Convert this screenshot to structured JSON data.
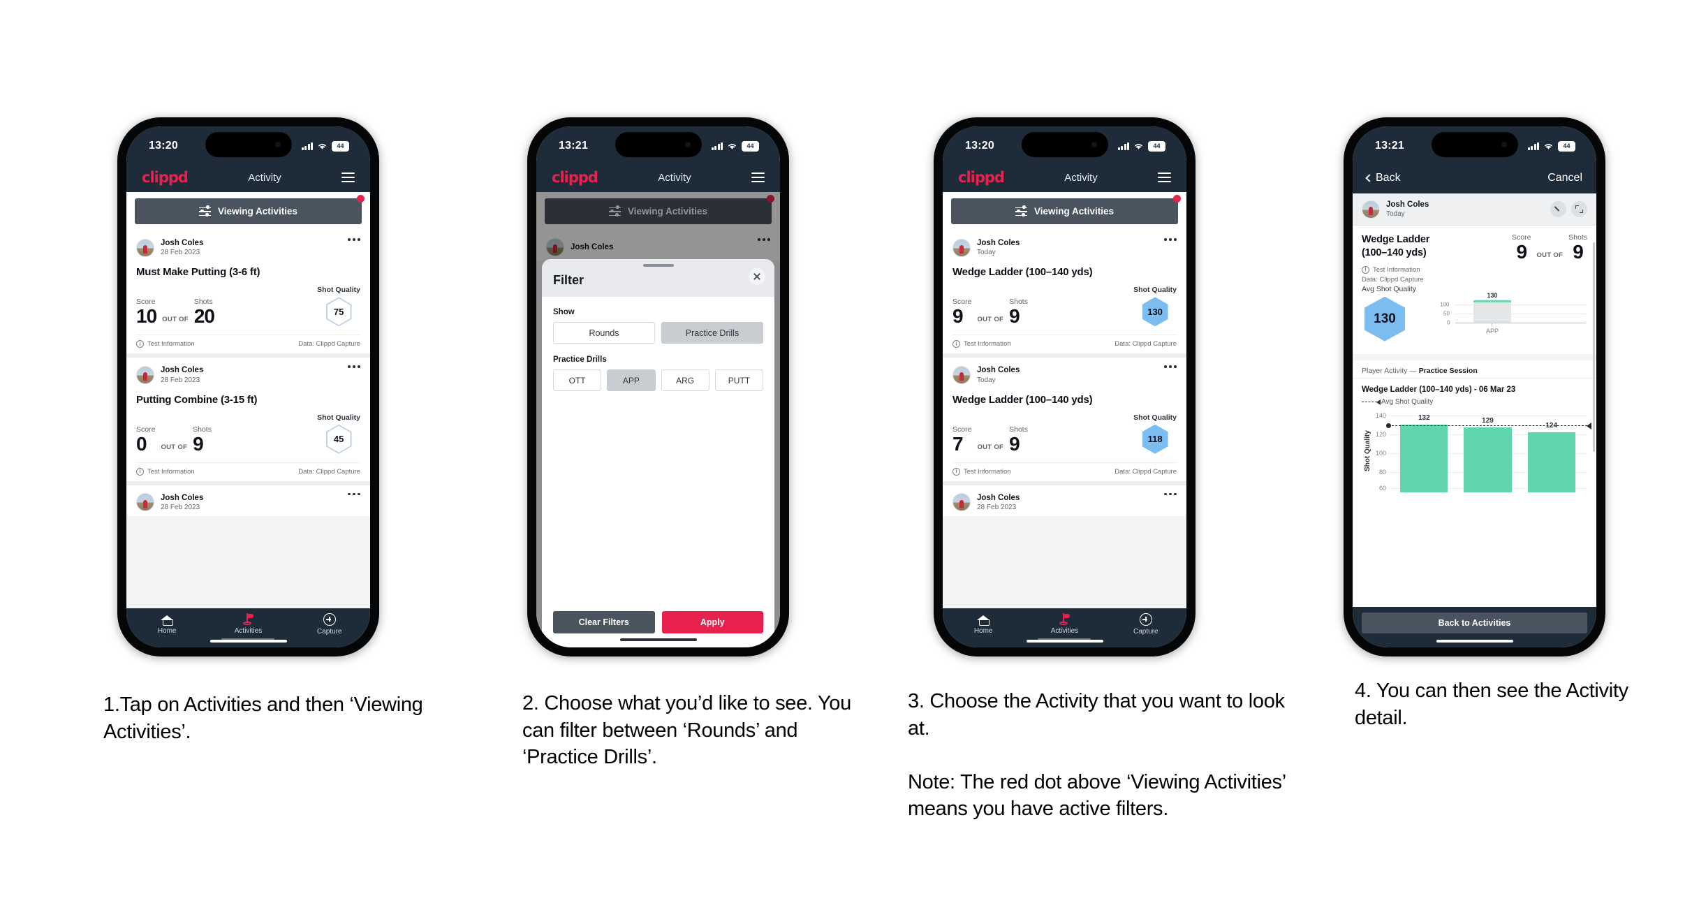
{
  "phones": [
    {
      "status": {
        "time": "13:20",
        "battery": "44"
      },
      "appbar": {
        "logo": "clippd",
        "title": "Activity"
      },
      "filter_button": {
        "label": "Viewing Activities",
        "has_badge": true
      },
      "cards": [
        {
          "user": "Josh Coles",
          "date": "28 Feb 2023",
          "title": "Must Make Putting (3-6 ft)",
          "score_label": "Score",
          "score": "10",
          "outof": "OUT OF",
          "shots_label": "Shots",
          "shots": "20",
          "quality_label": "Shot Quality",
          "quality": "75",
          "quality_style": "outline",
          "foot_left": "Test Information",
          "foot_right": "Data: Clippd Capture"
        },
        {
          "user": "Josh Coles",
          "date": "28 Feb 2023",
          "title": "Putting Combine (3-15 ft)",
          "score_label": "Score",
          "score": "0",
          "outof": "OUT OF",
          "shots_label": "Shots",
          "shots": "9",
          "quality_label": "Shot Quality",
          "quality": "45",
          "quality_style": "outline",
          "foot_left": "Test Information",
          "foot_right": "Data: Clippd Capture"
        }
      ],
      "partial_card": {
        "user": "Josh Coles",
        "date": "28 Feb 2023"
      },
      "tabs": [
        {
          "label": "Home",
          "icon": "home-icon",
          "active": false
        },
        {
          "label": "Activities",
          "icon": "golf-flag-icon",
          "active": true
        },
        {
          "label": "Capture",
          "icon": "plus-circle-icon",
          "active": false
        }
      ]
    },
    {
      "status": {
        "time": "13:21",
        "battery": "44"
      },
      "appbar": {
        "logo": "clippd",
        "title": "Activity"
      },
      "filter_button": {
        "label": "Viewing Activities",
        "has_badge": true
      },
      "bg_card_user": "Josh Coles",
      "sheet": {
        "title": "Filter",
        "show_label": "Show",
        "show_options": [
          {
            "label": "Rounds",
            "selected": false
          },
          {
            "label": "Practice Drills",
            "selected": true
          }
        ],
        "drills_label": "Practice Drills",
        "drill_options": [
          {
            "label": "OTT",
            "selected": false
          },
          {
            "label": "APP",
            "selected": true
          },
          {
            "label": "ARG",
            "selected": false
          },
          {
            "label": "PUTT",
            "selected": false
          }
        ],
        "clear_label": "Clear Filters",
        "apply_label": "Apply"
      }
    },
    {
      "status": {
        "time": "13:20",
        "battery": "44"
      },
      "appbar": {
        "logo": "clippd",
        "title": "Activity"
      },
      "filter_button": {
        "label": "Viewing Activities",
        "has_badge": true
      },
      "cards": [
        {
          "user": "Josh Coles",
          "date": "Today",
          "title": "Wedge Ladder (100–140 yds)",
          "score_label": "Score",
          "score": "9",
          "outof": "OUT OF",
          "shots_label": "Shots",
          "shots": "9",
          "quality_label": "Shot Quality",
          "quality": "130",
          "quality_style": "filled",
          "foot_left": "Test Information",
          "foot_right": "Data: Clippd Capture"
        },
        {
          "user": "Josh Coles",
          "date": "Today",
          "title": "Wedge Ladder (100–140 yds)",
          "score_label": "Score",
          "score": "7",
          "outof": "OUT OF",
          "shots_label": "Shots",
          "shots": "9",
          "quality_label": "Shot Quality",
          "quality": "118",
          "quality_style": "filled",
          "foot_left": "Test Information",
          "foot_right": "Data: Clippd Capture"
        }
      ],
      "partial_card": {
        "user": "Josh Coles",
        "date": "28 Feb 2023"
      },
      "tabs": [
        {
          "label": "Home",
          "icon": "home-icon",
          "active": false
        },
        {
          "label": "Activities",
          "icon": "golf-flag-icon",
          "active": true
        },
        {
          "label": "Capture",
          "icon": "plus-circle-icon",
          "active": false
        }
      ]
    },
    {
      "status": {
        "time": "13:21",
        "battery": "44"
      },
      "navbar": {
        "back": "Back",
        "cancel": "Cancel"
      },
      "detail_head": {
        "user": "Josh Coles",
        "date": "Today"
      },
      "detail": {
        "title": "Wedge Ladder (100–140 yds)",
        "score_label": "Score",
        "score": "9",
        "outof": "OUT OF",
        "shots_label": "Shots",
        "shots": "9",
        "info_line1": "Test Information",
        "info_line2": "Data: Clippd Capture",
        "avg_label": "Avg Shot Quality",
        "avg_value": "130"
      },
      "player_activity": {
        "prefix": "Player Activity — ",
        "value": "Practice Session"
      },
      "back_button": "Back to Activities"
    }
  ],
  "captions": [
    "1.Tap on Activities and then ‘Viewing Activities’.",
    "2. Choose what you’d like to see. You can filter between ‘Rounds’ and ‘Practice Drills’.",
    "3. Choose the Activity that you want to look at.\n\nNote: The red dot above ‘Viewing Activities’ means you have active filters.",
    "4. You can then see the Activity detail."
  ],
  "chart_data": [
    {
      "type": "bar",
      "title": "Avg Shot Quality",
      "categories": [
        "APP"
      ],
      "values": [
        130
      ],
      "value_labels": [
        "130"
      ],
      "ylabel": "",
      "yticks": [
        0,
        50,
        100
      ],
      "ylim": [
        0,
        145
      ],
      "grid": true,
      "legend": null,
      "bar_color": "#e4e6e8",
      "cap_color": "#5fd6ad"
    },
    {
      "type": "bar",
      "title": "Wedge Ladder (100–140 yds) - 06 Mar 23",
      "legend_label": "Avg Shot Quality",
      "categories": [
        "1",
        "2",
        "3"
      ],
      "values": [
        132,
        129,
        124
      ],
      "value_labels": [
        "132",
        "129",
        "124"
      ],
      "ylabel": "Shot Quality",
      "yticks": [
        60,
        80,
        100,
        120,
        140
      ],
      "ylim": [
        50,
        145
      ],
      "avg_line": 131,
      "grid": true,
      "bar_color": "#5fd6ad"
    }
  ],
  "colors": {
    "brand_red": "#e8224e",
    "header_navy": "#1e2c3a",
    "slate": "#4a545e",
    "hex_blue": "#7bbdf0",
    "bar_green": "#5fd6ad"
  }
}
